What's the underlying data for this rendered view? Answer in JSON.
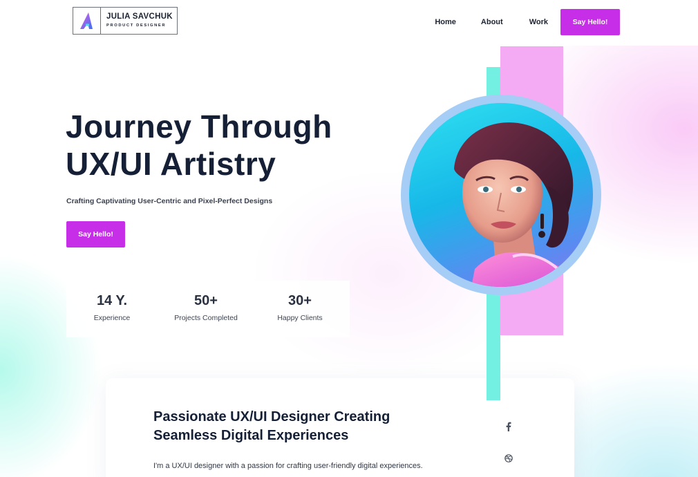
{
  "brand": {
    "name": "JULIA SAVCHUK",
    "role": "PRODUCT DESIGNER",
    "logo_icon": "letter-a-logo-icon"
  },
  "nav": {
    "links": [
      "Home",
      "About",
      "Work"
    ],
    "cta_label": "Say Hello!"
  },
  "hero": {
    "title_line1": "Journey Through",
    "title_line2": "UX/UI Artistry",
    "subtitle": "Crafting Captivating User-Centric and Pixel-Perfect Designs",
    "cta_label": "Say Hello!"
  },
  "stats": [
    {
      "value": "14 Y.",
      "label": "Experience"
    },
    {
      "value": "50+",
      "label": "Projects Completed"
    },
    {
      "value": "30+",
      "label": "Happy Clients"
    }
  ],
  "about": {
    "title_line1": "Passionate UX/UI Designer Creating",
    "title_line2": "Seamless Digital Experiences",
    "text": "I'm a UX/UI designer with a passion for crafting user-friendly digital experiences.",
    "social_icons": [
      "facebook-icon",
      "dribbble-icon"
    ]
  },
  "colors": {
    "accent": "#c62ee8",
    "pink_block": "#f4a7f2",
    "teal_block": "#6cefe0",
    "ring": "#a6cdf6",
    "heading": "#152036"
  }
}
